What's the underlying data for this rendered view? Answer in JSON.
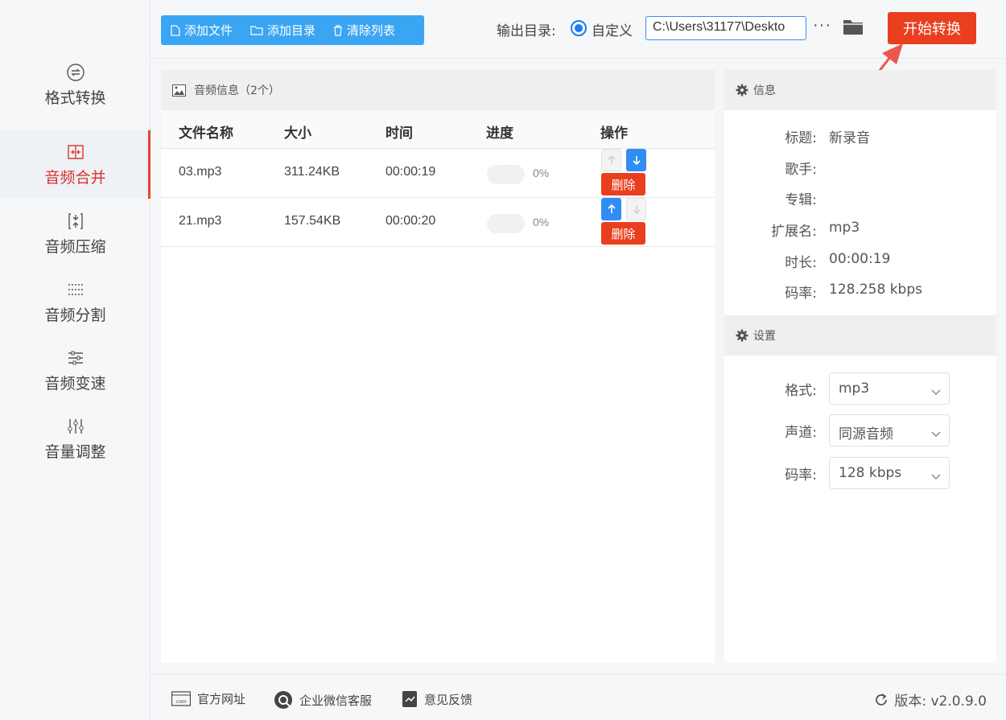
{
  "sidebar": {
    "items": [
      {
        "label": "格式转换",
        "icon": "swap-circle-icon"
      },
      {
        "label": "音频合并",
        "icon": "merge-icon"
      },
      {
        "label": "音频压缩",
        "icon": "compress-icon"
      },
      {
        "label": "音频分割",
        "icon": "split-icon"
      },
      {
        "label": "音频变速",
        "icon": "speed-icon"
      },
      {
        "label": "音量调整",
        "icon": "volume-sliders-icon"
      }
    ],
    "active_index": 1
  },
  "toolbar": {
    "add_file": "添加文件",
    "add_dir": "添加目录",
    "clear_list": "清除列表",
    "output_label": "输出目录:",
    "radio_label": "自定义",
    "output_path": "C:\\Users\\31177\\Deskto",
    "more": "···",
    "start": "开始转换"
  },
  "file_panel": {
    "title": "音频信息（2个）",
    "columns": [
      "文件名称",
      "大小",
      "时间",
      "进度",
      "操作"
    ],
    "rows": [
      {
        "name": "03.mp3",
        "size": "311.24KB",
        "time": "00:00:19",
        "progress": "0%",
        "progress_value": 0,
        "up_enabled": false,
        "down_enabled": true
      },
      {
        "name": "21.mp3",
        "size": "157.54KB",
        "time": "00:00:20",
        "progress": "0%",
        "progress_value": 0,
        "up_enabled": true,
        "down_enabled": false
      }
    ],
    "delete_label": "删除"
  },
  "info": {
    "title": "信息",
    "fields": [
      {
        "key": "标题:",
        "value": "新录音"
      },
      {
        "key": "歌手:",
        "value": ""
      },
      {
        "key": "专辑:",
        "value": ""
      },
      {
        "key": "扩展名:",
        "value": "mp3"
      },
      {
        "key": "时长:",
        "value": "00:00:19"
      },
      {
        "key": "码率:",
        "value": "128.258 kbps"
      }
    ]
  },
  "settings": {
    "title": "设置",
    "fields": [
      {
        "key": "格式:",
        "value": "mp3"
      },
      {
        "key": "声道:",
        "value": "同源音频"
      },
      {
        "key": "码率:",
        "value": "128 kbps"
      }
    ]
  },
  "footer": {
    "website": "官方网址",
    "wechat": "企业微信客服",
    "feedback": "意见反馈",
    "version": "版本: v2.0.9.0"
  },
  "colors": {
    "accent_blue": "#3aa5f3",
    "start_red": "#ea3f1f",
    "active_red": "#d8342a"
  }
}
